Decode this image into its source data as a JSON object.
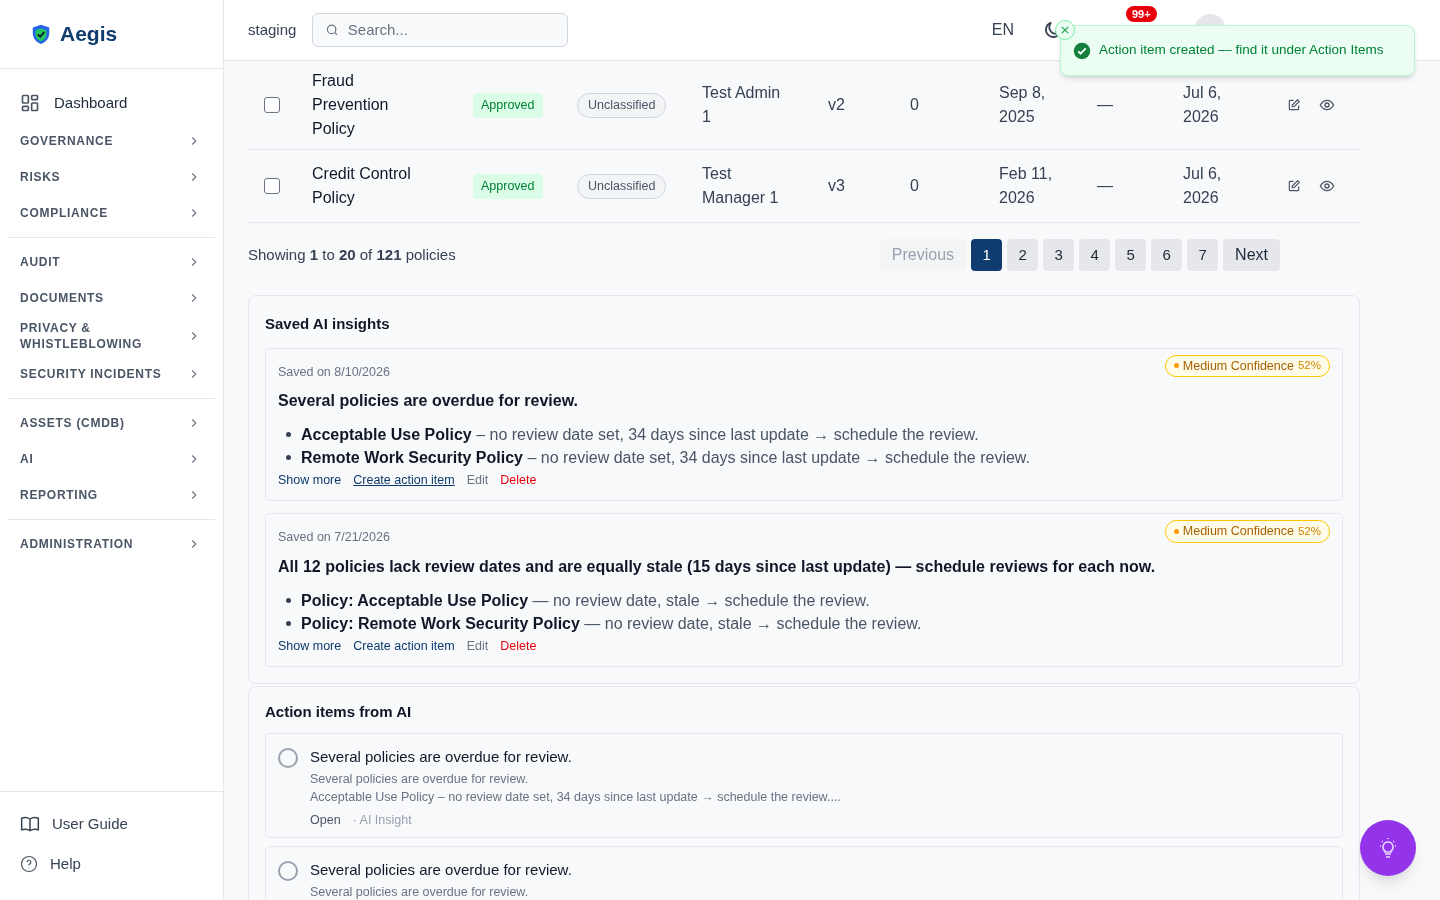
{
  "sidebar": {
    "brand": "Aegis",
    "groups": [
      {
        "items": [
          {
            "label": "Dashboard",
            "kind": "link"
          },
          {
            "label": "GOVERNANCE",
            "kind": "section"
          },
          {
            "label": "RISKS",
            "kind": "section"
          },
          {
            "label": "COMPLIANCE",
            "kind": "section"
          }
        ]
      },
      {
        "items": [
          {
            "label": "AUDIT",
            "kind": "section"
          },
          {
            "label": "DOCUMENTS",
            "kind": "section"
          },
          {
            "label": "PRIVACY & WHISTLEBLOWING",
            "kind": "section"
          },
          {
            "label": "SECURITY INCIDENTS",
            "kind": "section"
          }
        ]
      },
      {
        "items": [
          {
            "label": "ASSETS (CMDB)",
            "kind": "section"
          },
          {
            "label": "AI",
            "kind": "section"
          },
          {
            "label": "REPORTING",
            "kind": "section"
          }
        ]
      },
      {
        "items": [
          {
            "label": "ADMINISTRATION",
            "kind": "section"
          }
        ]
      }
    ],
    "footer": [
      {
        "label": "User Guide",
        "kind": "guide"
      },
      {
        "label": "Help",
        "kind": "help"
      }
    ]
  },
  "header": {
    "environment": "staging",
    "search": {
      "placeholder": "Search..."
    },
    "language": "EN",
    "notifications": "99+"
  },
  "toast": {
    "message": "Action item created — find it under Action Items"
  },
  "table": {
    "rows": [
      {
        "checked": false,
        "cells": [
          {
            "kind": "title",
            "text": "Fraud Prevention Policy"
          },
          {
            "kind": "status",
            "text": "Approved"
          },
          {
            "kind": "tag",
            "text": "Unclassified"
          },
          {
            "kind": "text",
            "text": "Test Admin 1"
          },
          {
            "kind": "text",
            "text": "v2"
          },
          {
            "kind": "text",
            "text": "0"
          },
          {
            "kind": "text",
            "text": "Sep 8, 2025"
          },
          {
            "kind": "text",
            "text": "—"
          },
          {
            "kind": "text",
            "text": "Jul 6, 2026"
          }
        ]
      },
      {
        "checked": false,
        "cells": [
          {
            "kind": "title",
            "text": "Credit Control Policy"
          },
          {
            "kind": "status",
            "text": "Approved"
          },
          {
            "kind": "tag",
            "text": "Unclassified"
          },
          {
            "kind": "text",
            "text": "Test Manager 1"
          },
          {
            "kind": "text",
            "text": "v3"
          },
          {
            "kind": "text",
            "text": "0"
          },
          {
            "kind": "text",
            "text": "Feb 11, 2026"
          },
          {
            "kind": "text",
            "text": "—"
          },
          {
            "kind": "text",
            "text": "Jul 6, 2026"
          }
        ]
      }
    ]
  },
  "pagination": {
    "summary": "Showing **1** to **20** of **121** policies",
    "previous": {
      "label": "Previous",
      "disabled": true
    },
    "pages": [
      {
        "label": "1",
        "selected": true
      },
      {
        "label": "2",
        "selected": false
      },
      {
        "label": "3",
        "selected": false
      },
      {
        "label": "4",
        "selected": false
      },
      {
        "label": "5",
        "selected": false
      },
      {
        "label": "6",
        "selected": false
      },
      {
        "label": "7",
        "selected": false
      }
    ],
    "next": {
      "label": "Next",
      "disabled": false
    }
  },
  "saved_insights": {
    "title": "Saved AI insights",
    "items": [
      {
        "saved": "Saved on 8/10/2026",
        "confidence": "Medium Confidence",
        "percent": "52%",
        "title": "Several policies are overdue for review.",
        "bullets": [
          "**Acceptable Use Policy** – no review date set, 34 days since last update → schedule the review.",
          "**Remote Work Security Policy** – no review date set, 34 days since last update → schedule the review."
        ],
        "actions": [
          {
            "label": "Show more",
            "kind": "link",
            "focused": false
          },
          {
            "label": "Create action item",
            "kind": "link",
            "focused": true
          },
          {
            "label": "Edit",
            "kind": "muted",
            "focused": false
          },
          {
            "label": "Delete",
            "kind": "danger",
            "focused": false
          }
        ]
      },
      {
        "saved": "Saved on 7/21/2026",
        "confidence": "Medium Confidence",
        "percent": "52%",
        "title": "All 12 policies lack review dates and are equally stale (15 days since last update) — schedule reviews for each now.",
        "bullets": [
          "**Policy: Acceptable Use Policy** — no review date, stale → schedule the review.",
          "**Policy: Remote Work Security Policy** — no review date, stale → schedule the review."
        ],
        "actions": [
          {
            "label": "Show more",
            "kind": "link",
            "focused": false
          },
          {
            "label": "Create action item",
            "kind": "link",
            "focused": false
          },
          {
            "label": "Edit",
            "kind": "muted",
            "focused": false
          },
          {
            "label": "Delete",
            "kind": "danger",
            "focused": false
          }
        ]
      }
    ]
  },
  "action_items": {
    "title": "Action items from AI",
    "items": [
      {
        "done": false,
        "title": "Several policies are overdue for review.",
        "lines": [
          "Several policies are overdue for review.",
          "Acceptable Use Policy – no review date set, 34 days since last update → schedule the review...."
        ],
        "status": "Open",
        "source": "· AI Insight"
      },
      {
        "done": false,
        "title": "Several policies are overdue for review.",
        "lines": [
          "Several policies are overdue for review."
        ]
      }
    ]
  }
}
